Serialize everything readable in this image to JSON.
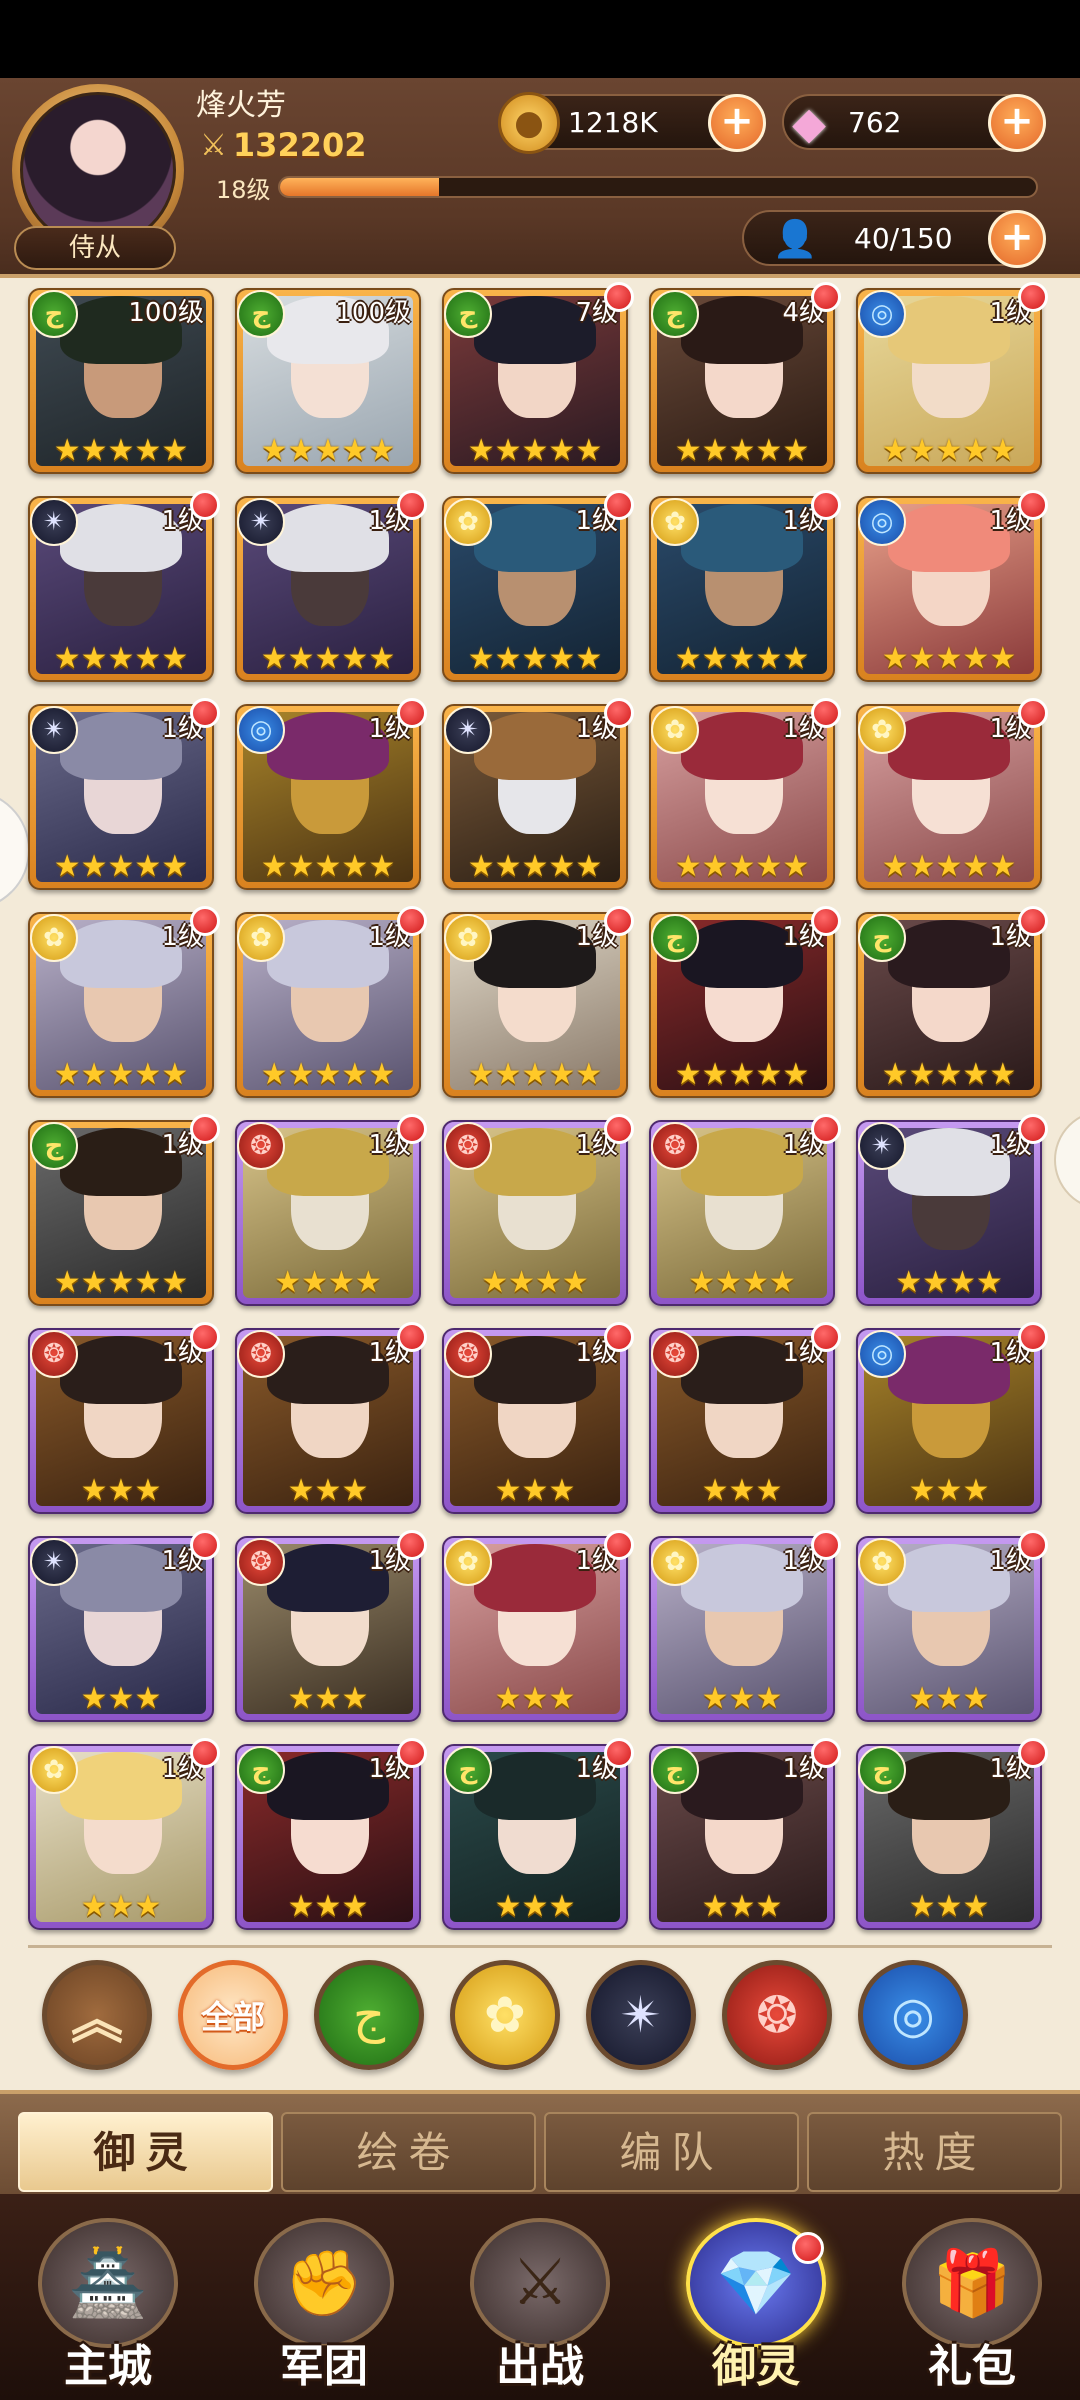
{
  "header": {
    "player_name": "烽火芳",
    "power": "132202",
    "level": "18级",
    "xp_fraction": 0.21,
    "role_tag": "侍从",
    "gold": "1218K",
    "gems": "762",
    "hero_count": "40/150",
    "plus": "+"
  },
  "heroes": [
    {
      "element": "wind",
      "elem_icon": "ج",
      "level": "100级",
      "stars": "★★★★★",
      "rarity": "orange",
      "dot": false,
      "bg1": "#3f4a52",
      "bg2": "#1e2428",
      "skin": "#c89a7a",
      "hair": "#1f2a1f"
    },
    {
      "element": "wind",
      "elem_icon": "ج",
      "level": "100级",
      "stars": "★★★★★",
      "rarity": "orange",
      "dot": false,
      "bg1": "#d8dde0",
      "bg2": "#9aa6b0",
      "skin": "#f4e0d4",
      "hair": "#e8e8ec"
    },
    {
      "element": "wind",
      "elem_icon": "ج",
      "level": "7级",
      "stars": "★★★★★",
      "rarity": "orange",
      "dot": true,
      "bg1": "#7a3a3a",
      "bg2": "#2a1a22",
      "skin": "#f2d6c6",
      "hair": "#1c1c2a"
    },
    {
      "element": "wind",
      "elem_icon": "ج",
      "level": "4级",
      "stars": "★★★★★",
      "rarity": "orange",
      "dot": true,
      "bg1": "#6a4a3a",
      "bg2": "#2a1a12",
      "skin": "#f4d8ca",
      "hair": "#2a1a16"
    },
    {
      "element": "water",
      "elem_icon": "◎",
      "level": "1级",
      "stars": "★★★★★",
      "rarity": "orange",
      "dot": true,
      "bg1": "#e8d89a",
      "bg2": "#c9a85a",
      "skin": "#f2dcc8",
      "hair": "#e6c878"
    },
    {
      "element": "dark",
      "elem_icon": "✴",
      "level": "1级",
      "stars": "★★★★★",
      "rarity": "orange",
      "dot": true,
      "bg1": "#5a4a7a",
      "bg2": "#2a2040",
      "skin": "#4a3a3a",
      "hair": "#e0e0e6"
    },
    {
      "element": "dark",
      "elem_icon": "✴",
      "level": "1级",
      "stars": "★★★★★",
      "rarity": "orange",
      "dot": true,
      "bg1": "#5a4a7a",
      "bg2": "#2a2040",
      "skin": "#4a3a3a",
      "hair": "#e0e0e6"
    },
    {
      "element": "light",
      "elem_icon": "✿",
      "level": "1级",
      "stars": "★★★★★",
      "rarity": "orange",
      "dot": true,
      "bg1": "#2a4a6a",
      "bg2": "#142434",
      "skin": "#b89070",
      "hair": "#2a5a7a"
    },
    {
      "element": "light",
      "elem_icon": "✿",
      "level": "1级",
      "stars": "★★★★★",
      "rarity": "orange",
      "dot": true,
      "bg1": "#2a4a6a",
      "bg2": "#142434",
      "skin": "#b89070",
      "hair": "#2a5a7a"
    },
    {
      "element": "water",
      "elem_icon": "◎",
      "level": "1级",
      "stars": "★★★★★",
      "rarity": "orange",
      "dot": true,
      "bg1": "#e8a08a",
      "bg2": "#8a3a3a",
      "skin": "#f4d6c6",
      "hair": "#f08a7a"
    },
    {
      "element": "dark",
      "elem_icon": "✴",
      "level": "1级",
      "stars": "★★★★★",
      "rarity": "orange",
      "dot": true,
      "bg1": "#6a6a8a",
      "bg2": "#2a2a4a",
      "skin": "#e8d6d6",
      "hair": "#8a8aa6"
    },
    {
      "element": "water",
      "elem_icon": "◎",
      "level": "1级",
      "stars": "★★★★★",
      "rarity": "orange",
      "dot": true,
      "bg1": "#a8842a",
      "bg2": "#4a3212",
      "skin": "#c99a3a",
      "hair": "#7a2a6a"
    },
    {
      "element": "dark",
      "elem_icon": "✴",
      "level": "1级",
      "stars": "★★★★★",
      "rarity": "orange",
      "dot": true,
      "bg1": "#7a5a3a",
      "bg2": "#2a1e14",
      "skin": "#e6e6ea",
      "hair": "#9a6a3a"
    },
    {
      "element": "light",
      "elem_icon": "✿",
      "level": "1级",
      "stars": "★★★★★",
      "rarity": "orange",
      "dot": true,
      "bg1": "#d8a0a0",
      "bg2": "#8a4a4a",
      "skin": "#f6e0d4",
      "hair": "#9a2a3a"
    },
    {
      "element": "light",
      "elem_icon": "✿",
      "level": "1级",
      "stars": "★★★★★",
      "rarity": "orange",
      "dot": true,
      "bg1": "#d8a0a0",
      "bg2": "#8a4a4a",
      "skin": "#f6e0d4",
      "hair": "#9a2a3a"
    },
    {
      "element": "light",
      "elem_icon": "✿",
      "level": "1级",
      "stars": "★★★★★",
      "rarity": "orange",
      "dot": true,
      "bg1": "#b8b0c8",
      "bg2": "#5a5470",
      "skin": "#e8c8b0",
      "hair": "#c8c8dc"
    },
    {
      "element": "light",
      "elem_icon": "✿",
      "level": "1级",
      "stars": "★★★★★",
      "rarity": "orange",
      "dot": true,
      "bg1": "#b8b0c8",
      "bg2": "#5a5470",
      "skin": "#e8c8b0",
      "hair": "#c8c8dc"
    },
    {
      "element": "light",
      "elem_icon": "✿",
      "level": "1级",
      "stars": "★★★★★",
      "rarity": "orange",
      "dot": true,
      "bg1": "#e0d8c8",
      "bg2": "#8a7a6a",
      "skin": "#f4dccc",
      "hair": "#1e1a1a"
    },
    {
      "element": "wind",
      "elem_icon": "ج",
      "level": "1级",
      "stars": "★★★★★",
      "rarity": "orange",
      "dot": true,
      "bg1": "#8a2a2a",
      "bg2": "#2a1014",
      "skin": "#f6dcd0",
      "hair": "#1a1622"
    },
    {
      "element": "wind",
      "elem_icon": "ج",
      "level": "1级",
      "stars": "★★★★★",
      "rarity": "orange",
      "dot": true,
      "bg1": "#6a4a4a",
      "bg2": "#2a1a1a",
      "skin": "#f4d8ca",
      "hair": "#2a1a1e"
    },
    {
      "element": "wind",
      "elem_icon": "ج",
      "level": "1级",
      "stars": "★★★★★",
      "rarity": "orange",
      "dot": true,
      "bg1": "#6a6a6a",
      "bg2": "#2a2a2a",
      "skin": "#e8c8b0",
      "hair": "#2a1e16"
    },
    {
      "element": "fire",
      "elem_icon": "❂",
      "level": "1级",
      "stars": "★★★★",
      "rarity": "purple",
      "dot": true,
      "bg1": "#d8c48a",
      "bg2": "#7a6a3a",
      "skin": "#e8e0d0",
      "hair": "#c8a84a"
    },
    {
      "element": "fire",
      "elem_icon": "❂",
      "level": "1级",
      "stars": "★★★★",
      "rarity": "purple",
      "dot": true,
      "bg1": "#d8c48a",
      "bg2": "#7a6a3a",
      "skin": "#e8e0d0",
      "hair": "#c8a84a"
    },
    {
      "element": "fire",
      "elem_icon": "❂",
      "level": "1级",
      "stars": "★★★★",
      "rarity": "purple",
      "dot": true,
      "bg1": "#d8c48a",
      "bg2": "#7a6a3a",
      "skin": "#e8e0d0",
      "hair": "#c8a84a"
    },
    {
      "element": "dark",
      "elem_icon": "✴",
      "level": "1级",
      "stars": "★★★★",
      "rarity": "purple",
      "dot": true,
      "bg1": "#5a4a7a",
      "bg2": "#2a2040",
      "skin": "#4a3a3a",
      "hair": "#e0e0e6"
    },
    {
      "element": "fire",
      "elem_icon": "❂",
      "level": "1级",
      "stars": "★★★",
      "rarity": "purple",
      "dot": true,
      "bg1": "#8a5a2a",
      "bg2": "#3a2210",
      "skin": "#f0d6c4",
      "hair": "#2a1e1a"
    },
    {
      "element": "fire",
      "elem_icon": "❂",
      "level": "1级",
      "stars": "★★★",
      "rarity": "purple",
      "dot": true,
      "bg1": "#8a5a2a",
      "bg2": "#3a2210",
      "skin": "#f0d6c4",
      "hair": "#2a1e1a"
    },
    {
      "element": "fire",
      "elem_icon": "❂",
      "level": "1级",
      "stars": "★★★",
      "rarity": "purple",
      "dot": true,
      "bg1": "#8a5a2a",
      "bg2": "#3a2210",
      "skin": "#f0d6c4",
      "hair": "#2a1e1a"
    },
    {
      "element": "fire",
      "elem_icon": "❂",
      "level": "1级",
      "stars": "★★★",
      "rarity": "purple",
      "dot": true,
      "bg1": "#8a5a2a",
      "bg2": "#3a2210",
      "skin": "#f0d6c4",
      "hair": "#2a1e1a"
    },
    {
      "element": "water",
      "elem_icon": "◎",
      "level": "1级",
      "stars": "★★★",
      "rarity": "purple",
      "dot": true,
      "bg1": "#a8842a",
      "bg2": "#4a3212",
      "skin": "#c99a3a",
      "hair": "#7a2a6a"
    },
    {
      "element": "dark",
      "elem_icon": "✴",
      "level": "1级",
      "stars": "★★★",
      "rarity": "purple",
      "dot": true,
      "bg1": "#6a6a8a",
      "bg2": "#2a2a4a",
      "skin": "#e8d6d6",
      "hair": "#8a8aa6"
    },
    {
      "element": "fire",
      "elem_icon": "❂",
      "level": "1级",
      "stars": "★★★",
      "rarity": "purple",
      "dot": true,
      "bg1": "#9a8a6a",
      "bg2": "#3a2e22",
      "skin": "#f2dccc",
      "hair": "#1e1e34"
    },
    {
      "element": "light",
      "elem_icon": "✿",
      "level": "1级",
      "stars": "★★★",
      "rarity": "purple",
      "dot": true,
      "bg1": "#d8a0a0",
      "bg2": "#8a4a4a",
      "skin": "#f6e0d4",
      "hair": "#9a2a3a"
    },
    {
      "element": "light",
      "elem_icon": "✿",
      "level": "1级",
      "stars": "★★★",
      "rarity": "purple",
      "dot": true,
      "bg1": "#b8b0c8",
      "bg2": "#5a5470",
      "skin": "#e8c8b0",
      "hair": "#c8c8dc"
    },
    {
      "element": "light",
      "elem_icon": "✿",
      "level": "1级",
      "stars": "★★★",
      "rarity": "purple",
      "dot": true,
      "bg1": "#b8b0c8",
      "bg2": "#5a5470",
      "skin": "#e8c8b0",
      "hair": "#c8c8dc"
    },
    {
      "element": "light",
      "elem_icon": "✿",
      "level": "1级",
      "stars": "★★★",
      "rarity": "purple",
      "dot": true,
      "bg1": "#e8e0c8",
      "bg2": "#a89a6a",
      "skin": "#f4dccc",
      "hair": "#f0d27a"
    },
    {
      "element": "wind",
      "elem_icon": "ج",
      "level": "1级",
      "stars": "★★★",
      "rarity": "purple",
      "dot": true,
      "bg1": "#8a2a2a",
      "bg2": "#2a1014",
      "skin": "#f6dcd0",
      "hair": "#1a1622"
    },
    {
      "element": "wind",
      "elem_icon": "ج",
      "level": "1级",
      "stars": "★★★",
      "rarity": "purple",
      "dot": true,
      "bg1": "#2a4a4a",
      "bg2": "#142222",
      "skin": "#f0dcd0",
      "hair": "#1a2a2a"
    },
    {
      "element": "wind",
      "elem_icon": "ج",
      "level": "1级",
      "stars": "★★★",
      "rarity": "purple",
      "dot": true,
      "bg1": "#6a4a4a",
      "bg2": "#2a1a1a",
      "skin": "#f4d8ca",
      "hair": "#2a1a1e"
    },
    {
      "element": "wind",
      "elem_icon": "ج",
      "level": "1级",
      "stars": "★★★",
      "rarity": "purple",
      "dot": true,
      "bg1": "#6a6a6a",
      "bg2": "#2a2a2a",
      "skin": "#e8c8b0",
      "hair": "#2a1e16"
    }
  ],
  "filters": {
    "collapse": "︽",
    "all": "全部",
    "wind": "ج",
    "light": "✿",
    "dark": "✴",
    "fire": "❂",
    "water": "◎"
  },
  "sub_tabs": [
    "御灵",
    "绘卷",
    "编队",
    "热度"
  ],
  "nav": [
    {
      "label": "主城",
      "icon": "🏯",
      "active": false,
      "dot": false
    },
    {
      "label": "军团",
      "icon": "✊",
      "active": false,
      "dot": false
    },
    {
      "label": "出战",
      "icon": "⚔",
      "active": false,
      "dot": false
    },
    {
      "label": "御灵",
      "icon": "💎",
      "active": true,
      "dot": true
    },
    {
      "label": "礼包",
      "icon": "🎁",
      "active": false,
      "dot": false
    }
  ],
  "colors": {
    "orange_frame": "#d9821f",
    "purple_frame": "#8d55c8",
    "star": "#ffc928",
    "accent": "#e4682a"
  }
}
